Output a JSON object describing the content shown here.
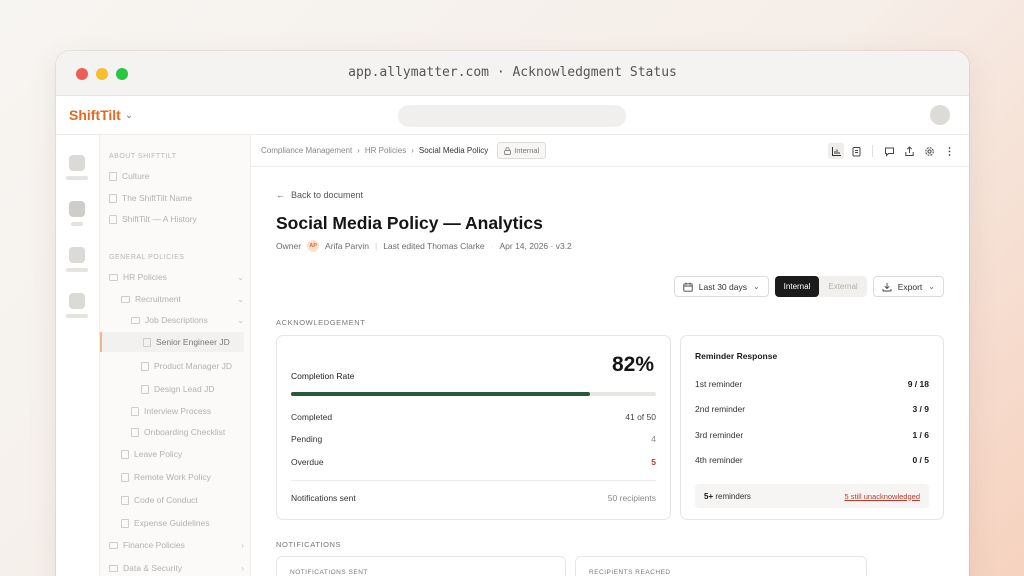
{
  "window": {
    "title": "app.allymatter.com · Acknowledgment Status"
  },
  "brand": {
    "name": "ShiftTilt"
  },
  "sidebar": {
    "sections": [
      {
        "label": "ABOUT SHIFTTILT"
      },
      {
        "label": "GENERAL POLICIES"
      }
    ],
    "items": [
      {
        "label": "Culture"
      },
      {
        "label": "The ShiftTilt Name"
      },
      {
        "label": "ShiftTilt — A History"
      },
      {
        "label": "HR Policies"
      },
      {
        "label": "Recruitment"
      },
      {
        "label": "Job Descriptions"
      },
      {
        "label": "Senior Engineer JD"
      },
      {
        "label": "Product Manager JD"
      },
      {
        "label": "Design Lead JD"
      },
      {
        "label": "Interview Process"
      },
      {
        "label": "Onboarding Checklist"
      },
      {
        "label": "Leave Policy"
      },
      {
        "label": "Remote Work Policy"
      },
      {
        "label": "Code of Conduct"
      },
      {
        "label": "Expense Guidelines"
      },
      {
        "label": "Finance Policies"
      },
      {
        "label": "Data & Security"
      }
    ]
  },
  "breadcrumb": {
    "items": [
      "Compliance Management",
      "HR Policies",
      "Social Media Policy"
    ],
    "separator": "›",
    "badge": "Internal"
  },
  "page": {
    "back": "Back to document",
    "title": "Social Media Policy — Analytics",
    "owner_label": "Owner",
    "owner_initials": "AP",
    "owner_name": "Arifa Parvin",
    "edited": "Last edited Thomas Clarke",
    "date": "Apr 14, 2026 · v3.2"
  },
  "controls": {
    "range": "Last 30 days",
    "seg_internal": "Internal",
    "seg_external": "External",
    "export": "Export"
  },
  "acknowledgement": {
    "section_label": "ACKNOWLEDGEMENT",
    "completion_label": "Completion Rate",
    "completion_value": "82%",
    "progress_fraction": 0.82,
    "completed_label": "Completed",
    "completed_value": "41 of 50",
    "pending_label": "Pending",
    "pending_value": "4",
    "overdue_label": "Overdue",
    "overdue_value": "5",
    "notif_label": "Notifications sent",
    "notif_value": "50 recipients"
  },
  "reminders": {
    "title": "Reminder Response",
    "rows": [
      {
        "label": "1st reminder",
        "value": "9 / 18"
      },
      {
        "label": "2nd reminder",
        "value": "3 / 9"
      },
      {
        "label": "3rd reminder",
        "value": "1 / 6"
      },
      {
        "label": "4th reminder",
        "value": "0 / 5"
      }
    ],
    "footer_bold": "5+",
    "footer_label": "reminders",
    "footer_link": "5 still unacknowledged"
  },
  "notifications": {
    "section_label": "NOTIFICATIONS",
    "card1": "NOTIFICATIONS SENT",
    "card2": "RECIPIENTS REACHED"
  },
  "colors": {
    "brand": "#e56a1f",
    "progress": "#245c3a",
    "danger": "#c0392b"
  }
}
